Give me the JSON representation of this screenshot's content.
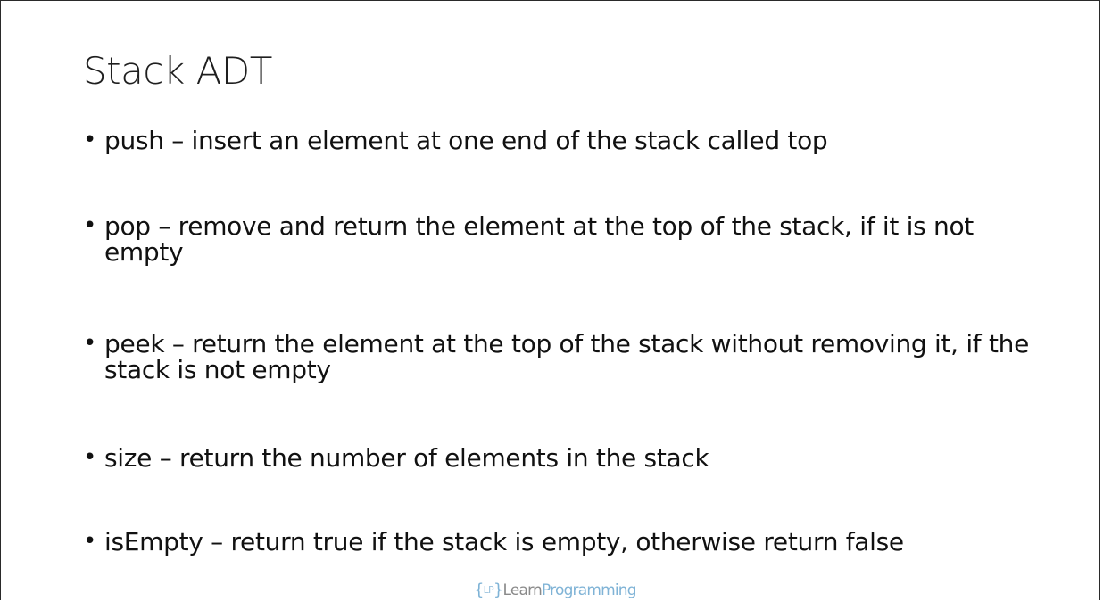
{
  "slide": {
    "title": "Stack ADT",
    "bullet_glyph": "•",
    "bullets": [
      {
        "text": "push – insert an element at one end of the stack called top"
      },
      {
        "text": "pop – remove and return the element at the top of the stack, if it is not empty"
      },
      {
        "text": "peek – return the element at the top of the stack without removing it, if the stack is not empty"
      },
      {
        "text": "size – return the number of elements in the stack"
      },
      {
        "text": "isEmpty – return true if the stack is empty, otherwise return false"
      }
    ]
  },
  "logo": {
    "open_brace": "{",
    "initials": "LP",
    "close_brace": "}",
    "learn": "Learn",
    "programming": "Programming"
  },
  "colors": {
    "text": "#111111",
    "logo_accent": "#7fb3d6",
    "logo_gray": "#8a8a8a"
  }
}
